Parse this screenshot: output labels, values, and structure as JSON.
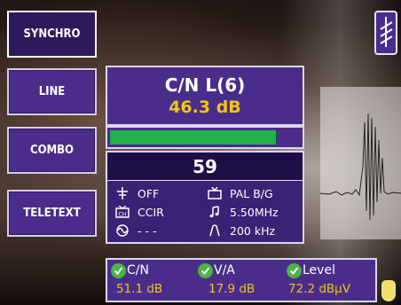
{
  "menu": {
    "synchro": "SYNCHRO",
    "line": "LINE",
    "combo": "COMBO",
    "teletext": "TELETEXT"
  },
  "measurement": {
    "title": "C/N L(6)",
    "value": "46.3 dB",
    "level_fraction": 0.88
  },
  "channel": "59",
  "info": {
    "sound": "OFF",
    "standard": "PAL B/G",
    "color_system": "CCIR",
    "sound_carrier": "5.50MHz",
    "other": "- - -",
    "bandwidth": "200 kHz"
  },
  "status": {
    "cn_label": "C/N",
    "cn_value": "51.1 dB",
    "va_label": "V/A",
    "va_value": "17.9 dB",
    "level_label": "Level",
    "level_value": "72.2 dBµV"
  },
  "colors": {
    "panel": "#4a2d8a",
    "value_yellow": "#f0c419",
    "bar_green": "#22b14c",
    "check_green": "#4bb543"
  },
  "icons": {
    "antenna": "antenna-icon",
    "sound": "sound-off-icon",
    "tv": "tv-icon",
    "color": "color-system-icon",
    "note": "music-note-icon",
    "wave": "sine-wave-icon",
    "bandwidth": "bandwidth-icon",
    "check": "check-icon"
  }
}
